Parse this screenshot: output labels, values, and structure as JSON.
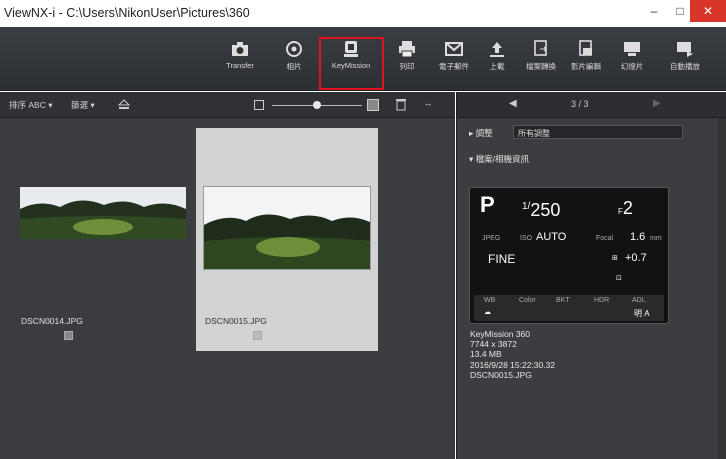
{
  "window": {
    "title": "ViewNX-i - C:\\Users\\NikonUser\\Pictures\\360",
    "controls": {
      "minimize": "–",
      "maximize": "□",
      "close": "✕"
    }
  },
  "toolbar": {
    "items": [
      {
        "label": "Transfer",
        "icon": "camera-icon"
      },
      {
        "label": "相片",
        "icon": "photo-icon"
      },
      {
        "label": "KeyMission",
        "icon": "keymission-icon"
      },
      {
        "label": "列印",
        "icon": "print-icon"
      },
      {
        "label": "電子郵件",
        "icon": "mail-icon"
      },
      {
        "label": "上載",
        "icon": "upload-icon"
      },
      {
        "label": "檔案轉換",
        "icon": "convert-icon"
      },
      {
        "label": "影片編輯",
        "icon": "movie-edit-icon"
      },
      {
        "label": "幻燈片",
        "icon": "slideshow-icon"
      },
      {
        "label": "自動播放",
        "icon": "autoplay-icon"
      }
    ],
    "highlighted": "KeyMission",
    "highlight_color": "#e0141e"
  },
  "browser": {
    "sort_label": "排序 ABC ▾",
    "filter_label": "篩選 ▾",
    "thumbnails": [
      {
        "filename": "DSCN0014.JPG",
        "selected": false
      },
      {
        "filename": "DSCN0015.JPG",
        "selected": true
      }
    ]
  },
  "sidebar": {
    "nav": {
      "prev": "◀",
      "page": "3 / 3",
      "next": "▶"
    },
    "adjust_label": "▸ 調整",
    "adjust_value": "所有調整",
    "info_label": "▾ 檔案/相機資訊",
    "exposure": {
      "mode": "P",
      "shutter_prefix": "1/",
      "shutter": "250",
      "aperture_prefix": "F",
      "aperture": "2",
      "format": "JPEG",
      "iso_prefix": "ISO",
      "iso": "AUTO",
      "focal_label": "Focal",
      "focal": "1.6",
      "focal_unit": "mm",
      "quality": "FINE",
      "exposure_comp": "+0.7",
      "wb_label": "WB",
      "color_label": "Color",
      "bkt_label": "BKT",
      "hdr_label": "HDR",
      "adl_label": "ADL",
      "adl_value": "明 A"
    },
    "camera": "KeyMission 360",
    "dimensions": "7744 x 3872",
    "filesize": "13.4 MB",
    "datetime": "2016/9/28 15:22:30.32",
    "filename": "DSCN0015.JPG"
  }
}
